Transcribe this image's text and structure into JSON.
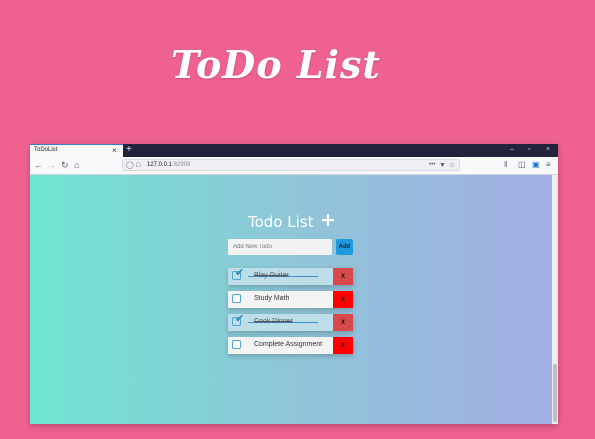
{
  "hero": {
    "title": "ToDo List"
  },
  "browser": {
    "tab_title": "ToDoList",
    "tab_close": "×",
    "new_tab": "+",
    "window_controls": [
      "–",
      "▫",
      "×"
    ],
    "url_host": "127.0.0.1",
    "url_port": ":62909"
  },
  "app": {
    "title": "Todo List",
    "add_icon": "+",
    "input_placeholder": "Add New Todo",
    "add_button_label": "Add",
    "delete_label": "X",
    "todos": [
      {
        "label": "Play Guitar",
        "completed": true
      },
      {
        "label": "Study Math",
        "completed": false
      },
      {
        "label": "Cook Dinner",
        "completed": true
      },
      {
        "label": "Complete Assignment",
        "completed": false
      }
    ]
  },
  "colors": {
    "page_background": "#ef6290",
    "gradient_start": "#6fe5d2",
    "gradient_end": "#a2aee4",
    "add_button": "#1e9be0",
    "delete_button": "#ff0000",
    "delete_button_done": "#d9484a"
  }
}
